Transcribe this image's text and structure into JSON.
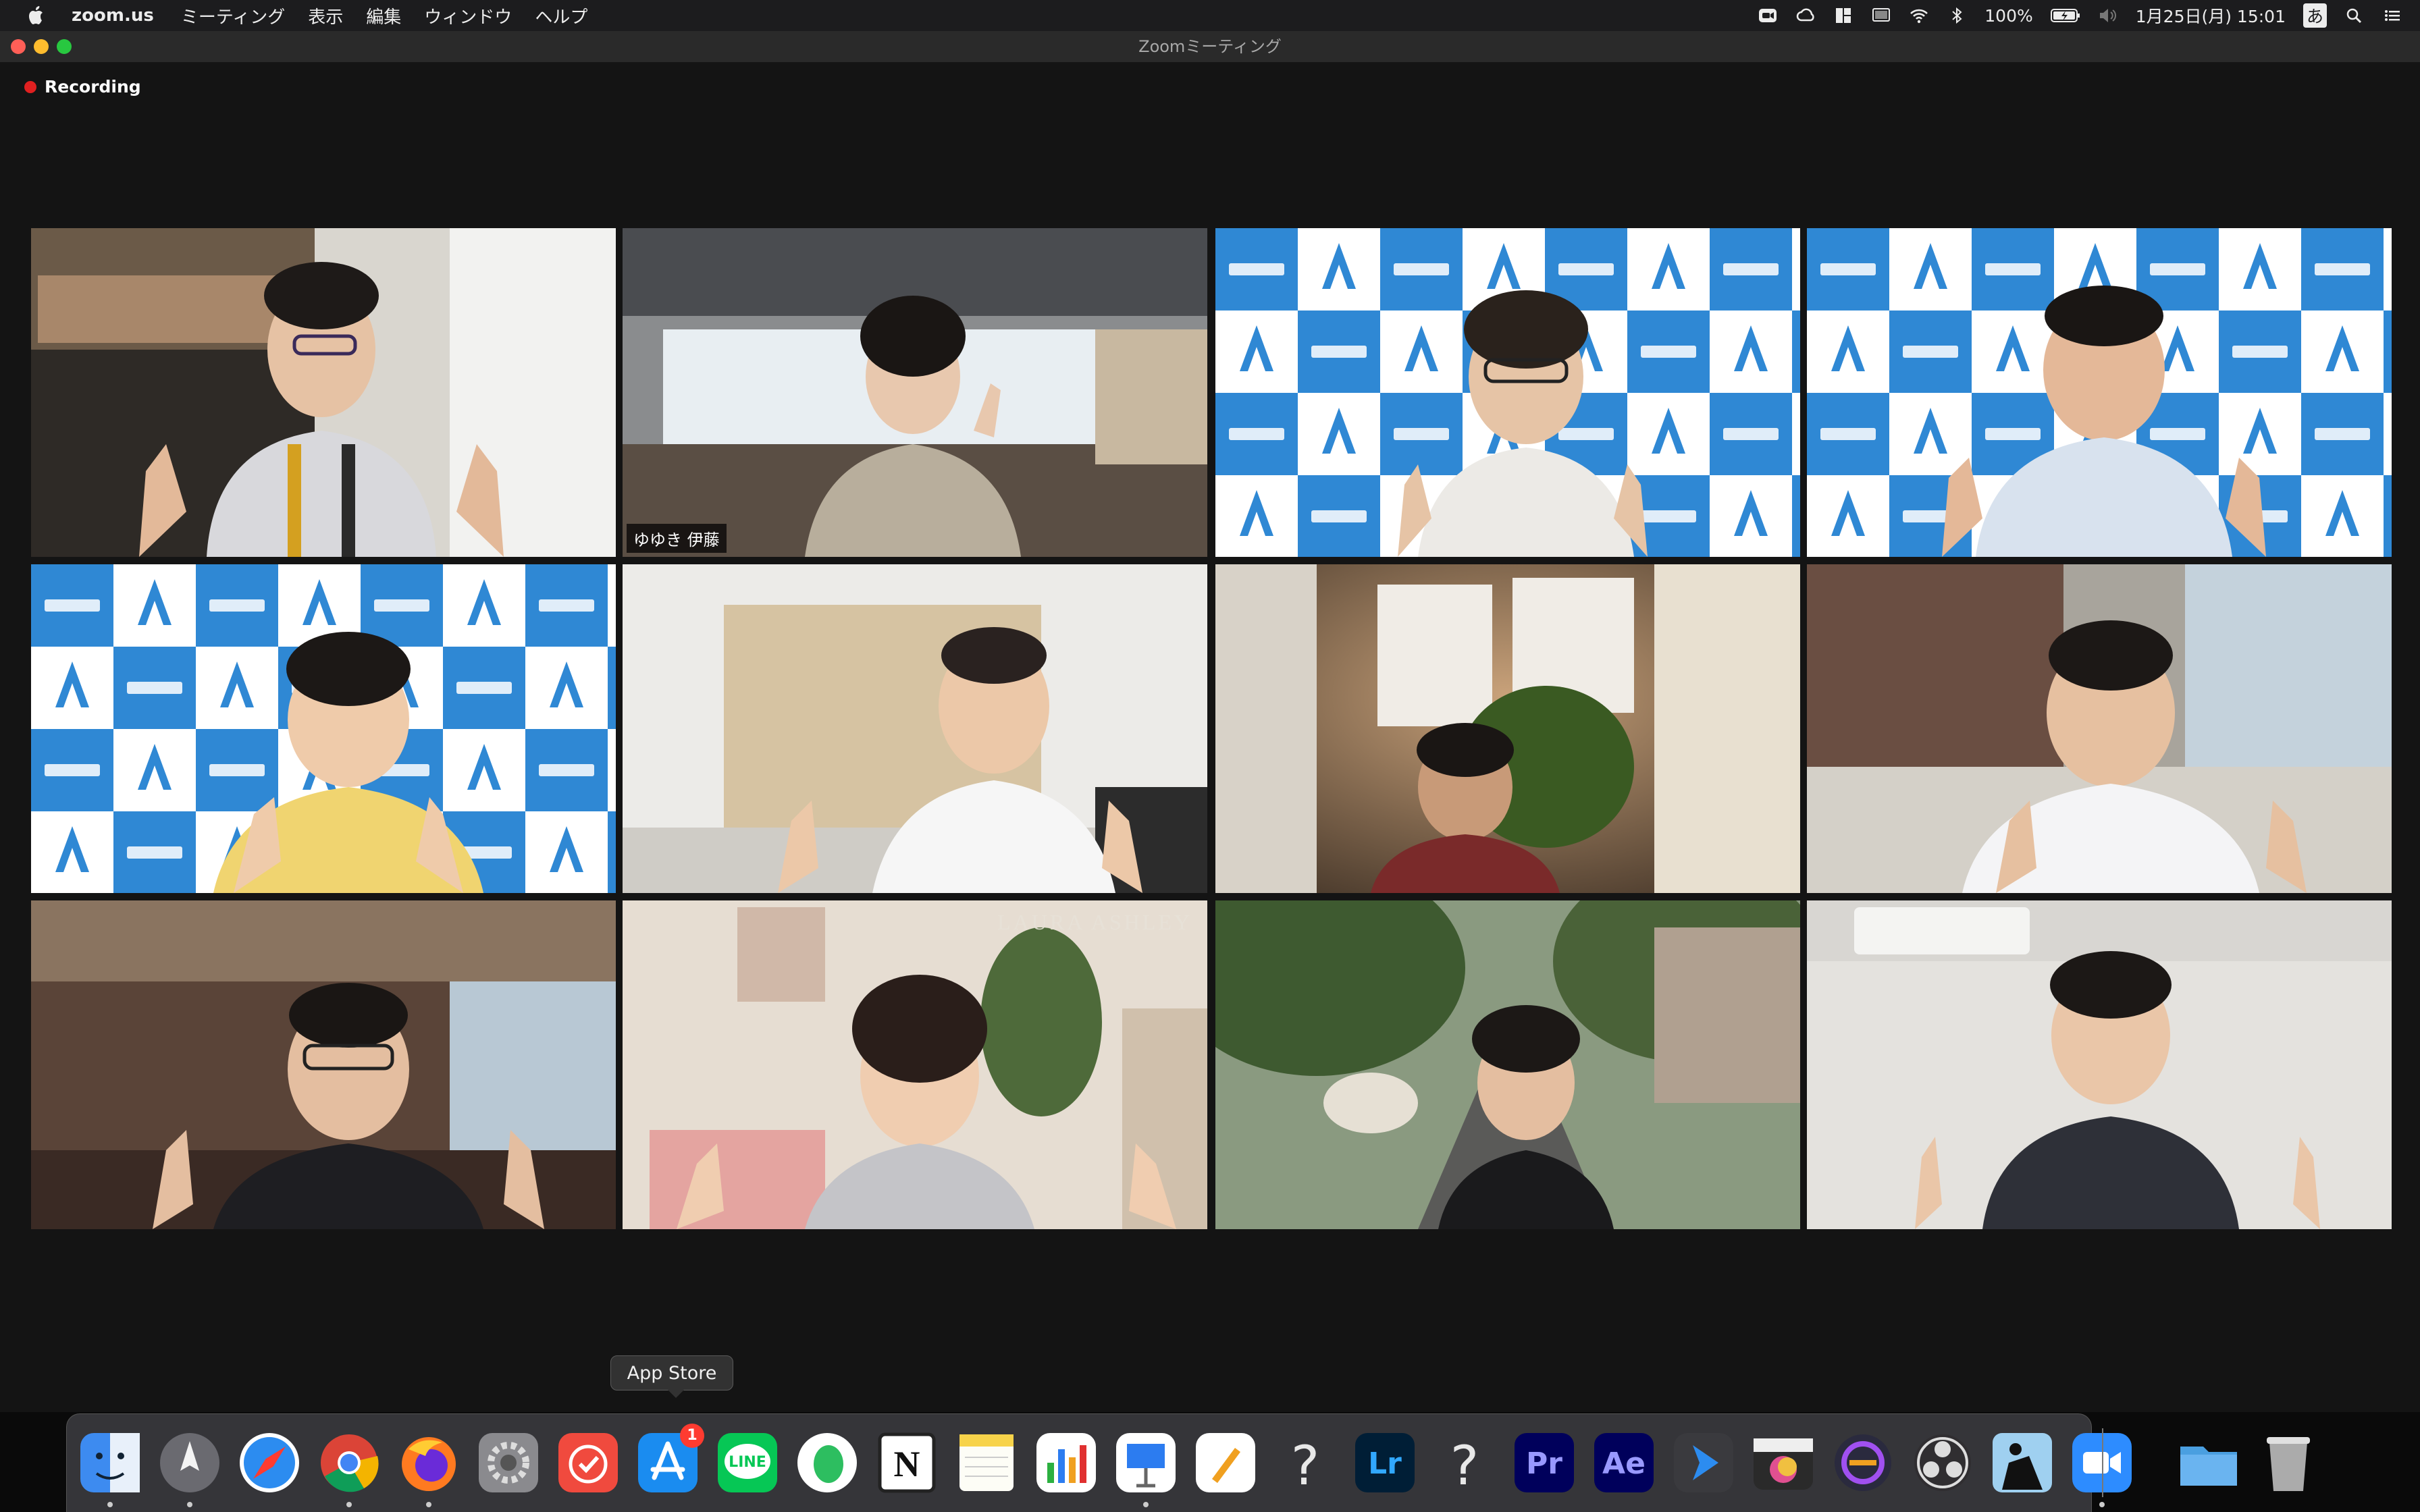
{
  "menubar": {
    "app_name": "zoom.us",
    "menus": [
      "ミーティング",
      "表示",
      "編集",
      "ウィンドウ",
      "ヘルプ"
    ],
    "battery": "100%",
    "clock": "1月25日(月)  15:01",
    "input_method": "あ"
  },
  "window": {
    "title": "Zoomミーティング"
  },
  "meeting": {
    "recording_label": "Recording",
    "active_speaker_name": "ゆゆき 伊藤",
    "tile_watermark": "LAURA ASHLEY"
  },
  "tooltip": {
    "text": "App Store"
  },
  "dock": {
    "items": [
      {
        "name": "finder-icon",
        "label": "Finder"
      },
      {
        "name": "launchpad-icon",
        "label": "Launchpad"
      },
      {
        "name": "safari-icon",
        "label": "Safari"
      },
      {
        "name": "chrome-icon",
        "label": "Chrome"
      },
      {
        "name": "firefox-icon",
        "label": "Firefox"
      },
      {
        "name": "system-preferences-icon",
        "label": "System Preferences"
      },
      {
        "name": "timer-app-icon",
        "label": "Timer"
      },
      {
        "name": "app-store-icon",
        "label": "App Store",
        "badge": "1"
      },
      {
        "name": "line-icon",
        "label": "LINE",
        "text": "LINE"
      },
      {
        "name": "evernote-icon",
        "label": "Evernote"
      },
      {
        "name": "notion-icon",
        "label": "Notion",
        "text": "N"
      },
      {
        "name": "notes-icon",
        "label": "Notes"
      },
      {
        "name": "numbers-icon",
        "label": "Numbers"
      },
      {
        "name": "keynote-icon",
        "label": "Keynote"
      },
      {
        "name": "pages-icon",
        "label": "Pages"
      },
      {
        "name": "unknown-app-icon",
        "label": "?",
        "text": "?"
      },
      {
        "name": "lightroom-icon",
        "label": "Lightroom",
        "text": "Lr"
      },
      {
        "name": "unknown-app-icon",
        "label": "?",
        "text": "?"
      },
      {
        "name": "premiere-icon",
        "label": "Premiere Pro",
        "text": "Pr"
      },
      {
        "name": "after-effects-icon",
        "label": "After Effects",
        "text": "Ae"
      },
      {
        "name": "screen-share-icon",
        "label": "Screen share"
      },
      {
        "name": "final-cut-icon",
        "label": "Final Cut Pro"
      },
      {
        "name": "motion-icon",
        "label": "Motion"
      },
      {
        "name": "obs-icon",
        "label": "OBS"
      },
      {
        "name": "kindle-icon",
        "label": "Kindle"
      },
      {
        "name": "zoom-icon",
        "label": "Zoom"
      },
      {
        "name": "folder-icon",
        "label": "Folder"
      },
      {
        "name": "trash-icon",
        "label": "Trash"
      }
    ]
  },
  "colors": {
    "active_border": "#e8f07a",
    "recording_dot": "#e02020",
    "any_inc_blue": "#2f88d4",
    "badge_red": "#ff3b30"
  }
}
